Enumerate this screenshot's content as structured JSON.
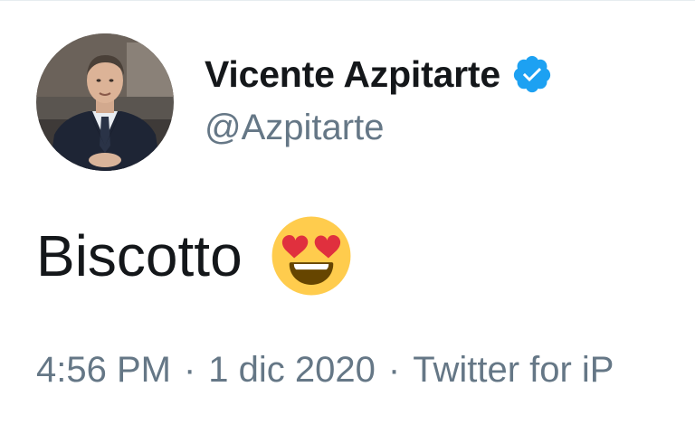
{
  "user": {
    "display_name": "Vicente Azpitarte",
    "handle": "@Azpitarte",
    "verified": true,
    "verified_icon": "verified-badge-icon",
    "avatar": "profile-photo"
  },
  "tweet": {
    "text": "Biscotto",
    "emoji": "heart-eyes-face-icon"
  },
  "meta": {
    "time": "4:56 PM",
    "separator": "·",
    "date": "1 dic 2020",
    "source": "Twitter for iP"
  },
  "colors": {
    "text_primary": "#14171a",
    "text_secondary": "#657786",
    "verified_blue": "#1da1f2"
  }
}
